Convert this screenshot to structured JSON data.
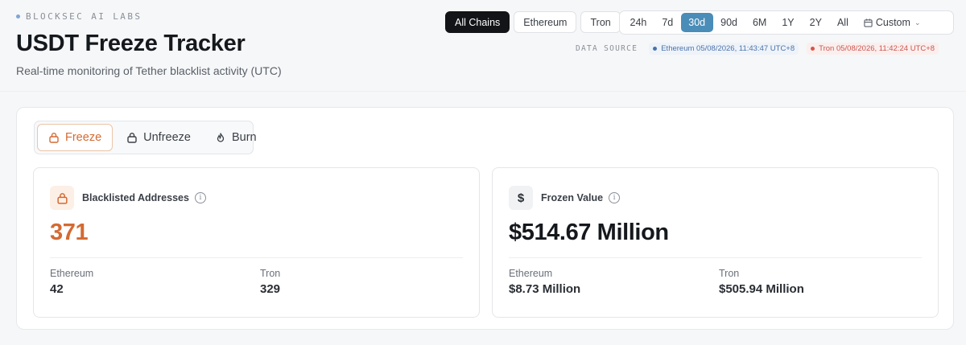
{
  "brand": "BLOCKSEC AI LABS",
  "title": "USDT Freeze Tracker",
  "subtitle": "Real-time monitoring of Tether blacklist activity (UTC)",
  "chains": [
    {
      "label": "All Chains",
      "active": true
    },
    {
      "label": "Ethereum",
      "active": false
    },
    {
      "label": "Tron",
      "active": false
    }
  ],
  "ranges": [
    {
      "label": "24h",
      "active": false
    },
    {
      "label": "7d",
      "active": false
    },
    {
      "label": "30d",
      "active": true
    },
    {
      "label": "90d",
      "active": false
    },
    {
      "label": "6M",
      "active": false
    },
    {
      "label": "1Y",
      "active": false
    },
    {
      "label": "2Y",
      "active": false
    },
    {
      "label": "All",
      "active": false
    }
  ],
  "custom_label": "Custom",
  "data_source": {
    "label": "DATA SOURCE",
    "ethereum": "Ethereum 05/08/2026, 11:43:47 UTC+8",
    "tron": "Tron 05/08/2026, 11:42:24 UTC+8"
  },
  "tabs": [
    {
      "label": "Freeze",
      "icon": "lock-icon",
      "active": true
    },
    {
      "label": "Unfreeze",
      "icon": "unlock-icon",
      "active": false
    },
    {
      "label": "Burn",
      "icon": "flame-icon",
      "active": false
    }
  ],
  "cards": {
    "blacklisted": {
      "label": "Blacklisted Addresses",
      "value": "371",
      "ethereum_label": "Ethereum",
      "ethereum_value": "42",
      "tron_label": "Tron",
      "tron_value": "329"
    },
    "frozen": {
      "label": "Frozen Value",
      "icon_glyph": "$",
      "value": "$514.67 Million",
      "ethereum_label": "Ethereum",
      "ethereum_value": "$8.73 Million",
      "tron_label": "Tron",
      "tron_value": "$505.94 Million"
    }
  },
  "colors": {
    "accent_orange": "#d46a32",
    "active_range": "#4a8db8",
    "ethereum": "#4b72a8",
    "tron": "#d9534a"
  }
}
